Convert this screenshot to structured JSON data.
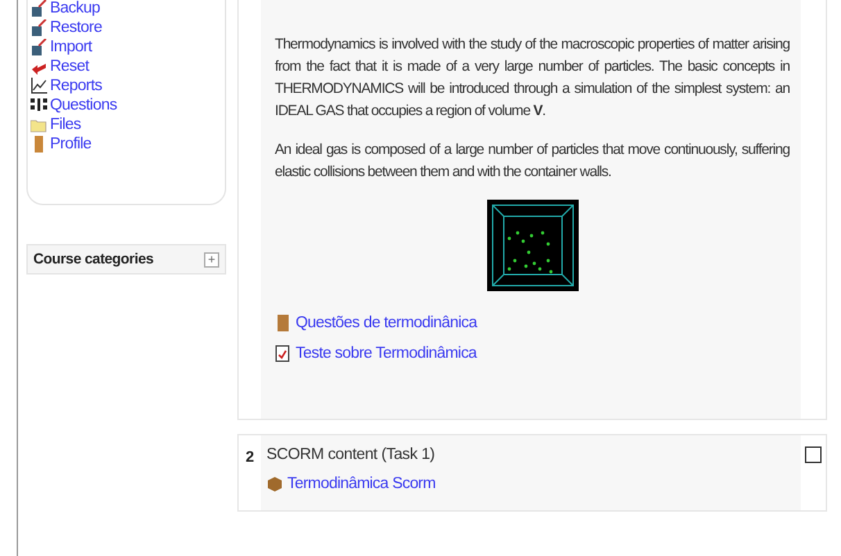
{
  "admin_menu": {
    "items": [
      {
        "label": "Backup",
        "kind": "backup"
      },
      {
        "label": "Restore",
        "kind": "restore"
      },
      {
        "label": "Import",
        "kind": "import"
      },
      {
        "label": "Reset",
        "kind": "reset"
      },
      {
        "label": "Reports",
        "kind": "reports"
      },
      {
        "label": "Questions",
        "kind": "questions"
      },
      {
        "label": "Files",
        "kind": "files"
      },
      {
        "label": "Profile",
        "kind": "profile"
      }
    ]
  },
  "course_categories": {
    "title": "Course categories",
    "toggle": "+"
  },
  "sections": [
    {
      "paragraphs": [
        "Thermodynamics is involved with the study of the macroscopic properties of matter arising from the fact that it is made of a very large number of particles. The basic concepts in THERMODYNAMICS will be introduced through a simulation of the simplest system: an IDEAL GAS that occupies a region of volume **V**.",
        "An ideal gas is composed of a large number of particles that move continuously, suffering elastic collisions between them and with the container walls."
      ],
      "has_simulation": true,
      "links": [
        {
          "label": "Questões de termodinânica",
          "kind": "quiz"
        },
        {
          "label": "Teste sobre Termodinâmica",
          "kind": "test"
        }
      ]
    },
    {
      "number": "2",
      "title": "SCORM content (Task 1)",
      "links": [
        {
          "label": "Termodinâmica Scorm",
          "kind": "scorm"
        }
      ],
      "checked": false
    }
  ]
}
